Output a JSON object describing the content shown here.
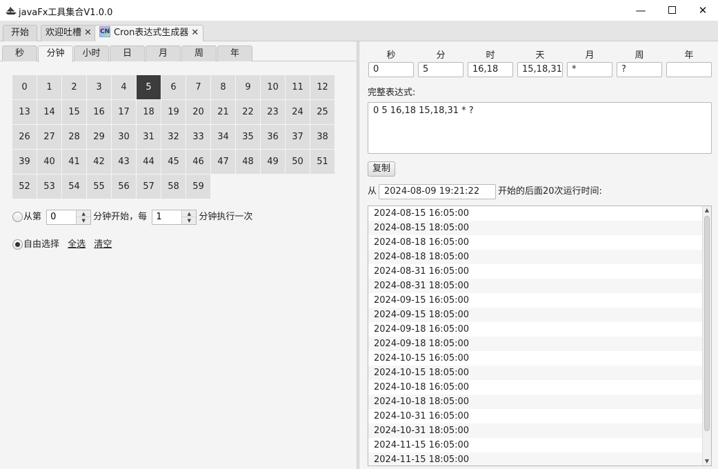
{
  "window": {
    "title": "javaFx工具集合V1.0.0",
    "min_glyph": "—",
    "close_glyph": "✕"
  },
  "main_tabs": [
    {
      "label": "开始"
    },
    {
      "label": "欢迎吐槽"
    },
    {
      "label": "Cron表达式生成器"
    }
  ],
  "tab_close_glyph": "✕",
  "cron_icon_text": "CN",
  "unit_tabs": [
    "秒",
    "分钟",
    "小时",
    "日",
    "月",
    "周",
    "年"
  ],
  "active_unit_tab": "分钟",
  "minute_grid": {
    "values": [
      "0",
      "1",
      "2",
      "3",
      "4",
      "5",
      "6",
      "7",
      "8",
      "9",
      "10",
      "11",
      "12",
      "13",
      "14",
      "15",
      "16",
      "17",
      "18",
      "19",
      "20",
      "21",
      "22",
      "23",
      "24",
      "25",
      "26",
      "27",
      "28",
      "29",
      "30",
      "31",
      "32",
      "33",
      "34",
      "35",
      "36",
      "37",
      "38",
      "39",
      "40",
      "41",
      "42",
      "43",
      "44",
      "45",
      "46",
      "47",
      "48",
      "49",
      "50",
      "51",
      "52",
      "53",
      "54",
      "55",
      "56",
      "57",
      "58",
      "59"
    ],
    "selected": [
      "5"
    ]
  },
  "interval_option": {
    "prefix": "从第",
    "start_value": "0",
    "middle": "分钟开始，每",
    "every_value": "1",
    "suffix": "分钟执行一次",
    "selected": false
  },
  "free_option": {
    "label": "自由选择",
    "select_all": "全选",
    "clear": "清空",
    "selected": true
  },
  "fields": {
    "labels": [
      "秒",
      "分",
      "时",
      "天",
      "月",
      "周",
      "年"
    ],
    "values": [
      "0",
      "5",
      "16,18",
      "15,18,31",
      "*",
      "?",
      ""
    ]
  },
  "expression": {
    "label": "完整表达式:",
    "value": "0 5 16,18 15,18,31 * ?"
  },
  "copy_label": "复制",
  "run_times": {
    "from_label": "从",
    "from_value": "2024-08-09 19:21:22",
    "suffix": "开始的后面20次运行时间:",
    "items": [
      "2024-08-15 16:05:00",
      "2024-08-15 18:05:00",
      "2024-08-18 16:05:00",
      "2024-08-18 18:05:00",
      "2024-08-31 16:05:00",
      "2024-08-31 18:05:00",
      "2024-09-15 16:05:00",
      "2024-09-15 18:05:00",
      "2024-09-18 16:05:00",
      "2024-09-18 18:05:00",
      "2024-10-15 16:05:00",
      "2024-10-15 18:05:00",
      "2024-10-18 16:05:00",
      "2024-10-18 18:05:00",
      "2024-10-31 16:05:00",
      "2024-10-31 18:05:00",
      "2024-11-15 16:05:00",
      "2024-11-15 18:05:00"
    ]
  },
  "scroll_arrows": {
    "up": "▲",
    "down": "▼"
  },
  "spinner_arrows": {
    "up": "▲",
    "down": "▼"
  }
}
